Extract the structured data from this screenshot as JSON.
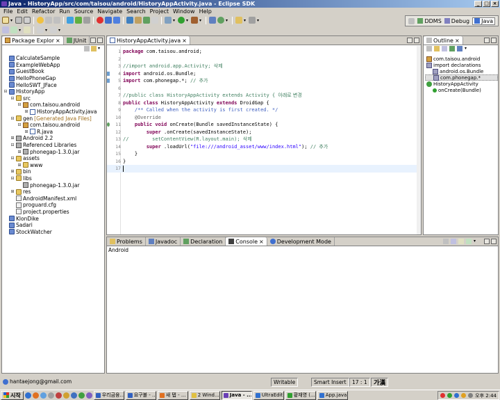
{
  "window": {
    "title": "Java - HistoryApp/src/com/taisou/android/HistoryAppActivity.java - Eclipse SDK"
  },
  "menu": [
    "File",
    "Edit",
    "Refactor",
    "Run",
    "Source",
    "Navigate",
    "Search",
    "Project",
    "Window",
    "Help"
  ],
  "perspectives": [
    {
      "label": "DDMS",
      "active": false
    },
    {
      "label": "Debug",
      "active": false
    },
    {
      "label": "Java",
      "active": true
    }
  ],
  "package_explorer": {
    "tabs": [
      "Package Explor",
      "JUnit"
    ],
    "tree": [
      {
        "depth": 0,
        "twisty": "",
        "icon": "project",
        "label": "CalculateSample"
      },
      {
        "depth": 0,
        "twisty": "",
        "icon": "project",
        "label": "ExampleWebApp"
      },
      {
        "depth": 0,
        "twisty": "",
        "icon": "project",
        "label": "GuestBook"
      },
      {
        "depth": 0,
        "twisty": "",
        "icon": "project",
        "label": "HelloPhoneGap"
      },
      {
        "depth": 0,
        "twisty": "",
        "icon": "project",
        "label": "HelloSWT_JFace"
      },
      {
        "depth": 0,
        "twisty": "-",
        "icon": "project",
        "label": "HistoryApp"
      },
      {
        "depth": 1,
        "twisty": "-",
        "icon": "folder",
        "label": "src"
      },
      {
        "depth": 2,
        "twisty": "-",
        "icon": "pkg",
        "label": "com.taisou.android"
      },
      {
        "depth": 3,
        "twisty": "+",
        "icon": "java",
        "label": "HistoryAppActivity.java"
      },
      {
        "depth": 1,
        "twisty": "-",
        "icon": "folder",
        "label": "gen",
        "note": "[Generated Java Files]"
      },
      {
        "depth": 2,
        "twisty": "-",
        "icon": "pkg",
        "label": "com.taisou.android"
      },
      {
        "depth": 3,
        "twisty": "+",
        "icon": "java",
        "label": "R.java"
      },
      {
        "depth": 1,
        "twisty": "+",
        "icon": "jar",
        "label": "Android 2.2"
      },
      {
        "depth": 1,
        "twisty": "-",
        "icon": "jar",
        "label": "Referenced Libraries"
      },
      {
        "depth": 2,
        "twisty": "+",
        "icon": "jar",
        "label": "phonegap-1.3.0.jar"
      },
      {
        "depth": 1,
        "twisty": "-",
        "icon": "folder",
        "label": "assets"
      },
      {
        "depth": 2,
        "twisty": "+",
        "icon": "folder",
        "label": "www"
      },
      {
        "depth": 1,
        "twisty": "+",
        "icon": "folder",
        "label": "bin"
      },
      {
        "depth": 1,
        "twisty": "-",
        "icon": "folder",
        "label": "libs"
      },
      {
        "depth": 2,
        "twisty": "",
        "icon": "jar",
        "label": "phonegap-1.3.0.jar"
      },
      {
        "depth": 1,
        "twisty": "+",
        "icon": "folder",
        "label": "res"
      },
      {
        "depth": 1,
        "twisty": "",
        "icon": "file",
        "label": "AndroidManifest.xml"
      },
      {
        "depth": 1,
        "twisty": "",
        "icon": "file",
        "label": "proguard.cfg"
      },
      {
        "depth": 1,
        "twisty": "",
        "icon": "file",
        "label": "project.properties"
      },
      {
        "depth": 0,
        "twisty": "",
        "icon": "project",
        "label": "KlonDike"
      },
      {
        "depth": 0,
        "twisty": "",
        "icon": "project",
        "label": "Sadari"
      },
      {
        "depth": 0,
        "twisty": "",
        "icon": "project",
        "label": "StockWatcher"
      }
    ]
  },
  "editor": {
    "tab": "HistoryAppActivity.java",
    "lines": [
      {
        "n": "1",
        "marker": "",
        "parts": [
          [
            "kw",
            "package"
          ],
          [
            "",
            "com.taisou.android;"
          ]
        ]
      },
      {
        "n": "2",
        "marker": "",
        "parts": []
      },
      {
        "n": "3",
        "marker": "",
        "parts": [
          [
            "cm",
            "//import android.app.Activity; "
          ],
          [
            "ko",
            "삭제"
          ]
        ]
      },
      {
        "n": "4",
        "marker": "change",
        "parts": [
          [
            "kw",
            "import"
          ],
          [
            "",
            "android.os.Bundle;"
          ]
        ]
      },
      {
        "n": "5",
        "marker": "change",
        "parts": [
          [
            "kw",
            "import"
          ],
          [
            "",
            "com.phonegap.*; "
          ],
          [
            "cm",
            "// "
          ],
          [
            "ko",
            "추가"
          ]
        ]
      },
      {
        "n": "6",
        "marker": "",
        "parts": []
      },
      {
        "n": "7",
        "marker": "",
        "parts": [
          [
            "cm",
            "//public class HistoryAppActivity extends Activity { "
          ],
          [
            "ko",
            "아래로 변경"
          ]
        ]
      },
      {
        "n": "8",
        "marker": "",
        "parts": [
          [
            "kw",
            "public class"
          ],
          [
            "",
            "HistoryAppActivity "
          ],
          [
            "kw",
            "extends"
          ],
          [
            "",
            "DroidGap {"
          ]
        ]
      },
      {
        "n": "9",
        "marker": "",
        "parts": [
          [
            "jd",
            "    /** Called when the activity is first created. */"
          ]
        ]
      },
      {
        "n": "10",
        "marker": "",
        "parts": [
          [
            "an",
            "    @Override"
          ]
        ]
      },
      {
        "n": "11",
        "marker": "override",
        "parts": [
          [
            "",
            "    "
          ],
          [
            "kw",
            "public void"
          ],
          [
            "",
            "onCreate(Bundle savedInstanceState) {"
          ]
        ]
      },
      {
        "n": "12",
        "marker": "",
        "parts": [
          [
            "",
            "        "
          ],
          [
            "kw",
            "super"
          ],
          [
            "",
            ".onCreate(savedInstanceState);"
          ]
        ]
      },
      {
        "n": "13",
        "marker": "",
        "parts": [
          [
            "cm",
            "//        setContentView(R.layout.main); "
          ],
          [
            "ko",
            "삭제"
          ]
        ]
      },
      {
        "n": "14",
        "marker": "",
        "parts": [
          [
            "",
            "        "
          ],
          [
            "kw",
            "super"
          ],
          [
            "",
            ".loadUrl("
          ],
          [
            "st",
            "\"file:///android_asset/www/index.html\""
          ],
          [
            "",
            "); "
          ],
          [
            "cm",
            "// "
          ],
          [
            "ko",
            "추가"
          ]
        ]
      },
      {
        "n": "15",
        "marker": "",
        "parts": [
          [
            "",
            "    }"
          ]
        ]
      },
      {
        "n": "16",
        "marker": "",
        "parts": [
          [
            "",
            "}"
          ]
        ]
      },
      {
        "n": "17",
        "marker": "",
        "parts": []
      }
    ]
  },
  "outline": {
    "tab": "Outline",
    "tree": [
      {
        "depth": 0,
        "icon": "pkg",
        "label": "com.taisou.android",
        "selected": false
      },
      {
        "depth": 0,
        "icon": "import",
        "label": "import declarations",
        "selected": false
      },
      {
        "depth": 1,
        "icon": "import",
        "label": "android.os.Bundle",
        "selected": false
      },
      {
        "depth": 1,
        "icon": "import",
        "label": "com.phonegap.*",
        "selected": true
      },
      {
        "depth": 0,
        "icon": "class",
        "label": "HistoryAppActivity",
        "selected": false
      },
      {
        "depth": 1,
        "icon": "method",
        "label": "onCreate(Bundle)",
        "selected": false
      }
    ]
  },
  "bottom": {
    "tabs": [
      {
        "label": "Problems",
        "active": false
      },
      {
        "label": "Javadoc",
        "active": false
      },
      {
        "label": "Declaration",
        "active": false
      },
      {
        "label": "Console",
        "active": true
      },
      {
        "label": "Development Mode",
        "active": false
      }
    ],
    "console_text": "Android"
  },
  "status": {
    "user": "hantaejong@gmail.com",
    "writable": "Writable",
    "insert": "Smart Insert",
    "position": "17 : 1",
    "ime": "가漢"
  },
  "taskbar": {
    "start": "시작",
    "tasks": [
      {
        "label": "우리금융...",
        "active": false,
        "color": "#3060c0"
      },
      {
        "label": "요구불 - ...",
        "active": false,
        "color": "#3060c0"
      },
      {
        "label": "새 탭 - ...",
        "active": false,
        "color": "#e07020"
      },
      {
        "label": "2 Wind...",
        "active": false,
        "color": "#e0c040"
      },
      {
        "label": "Java - ...",
        "active": true,
        "color": "#6a3fb5"
      },
      {
        "label": "UltraEdit ...",
        "active": false,
        "color": "#3070d0"
      },
      {
        "label": "황재영 (...",
        "active": false,
        "color": "#30a030"
      },
      {
        "label": "App.java...",
        "active": false,
        "color": "#3070d0"
      }
    ],
    "clock": "오후 2:44"
  },
  "colors": {
    "titlebar": "#0a246a",
    "keyword": "#7f0055",
    "comment": "#3f7f5f",
    "javadoc": "#3f5fbf",
    "string": "#2a00ff"
  }
}
